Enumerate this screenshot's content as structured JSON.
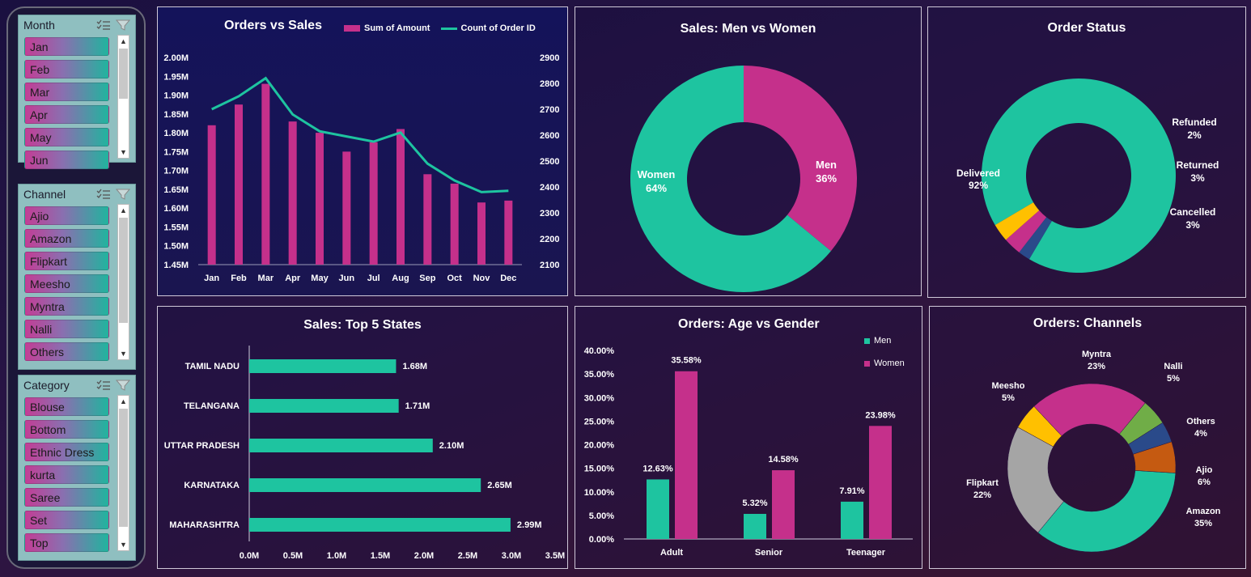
{
  "colors": {
    "teal": "#1ec4a0",
    "magenta": "#c5308b",
    "yellow": "#ffc000",
    "navy": "#2a4a8a",
    "orange": "#c55a11",
    "green": "#70ad47",
    "gray": "#a5a5a5"
  },
  "slicers": {
    "month": {
      "title": "Month",
      "items": [
        "Jan",
        "Feb",
        "Mar",
        "Apr",
        "May",
        "Jun"
      ]
    },
    "channel": {
      "title": "Channel",
      "items": [
        "Ajio",
        "Amazon",
        "Flipkart",
        "Meesho",
        "Myntra",
        "Nalli",
        "Others"
      ]
    },
    "category": {
      "title": "Category",
      "items": [
        "Blouse",
        "Bottom",
        "Ethnic Dress",
        "kurta",
        "Saree",
        "Set",
        "Top"
      ]
    }
  },
  "orders_vs_sales": {
    "title": "Orders vs Sales",
    "legend": {
      "amount": "Sum of Amount",
      "count": "Count of Order ID"
    }
  },
  "men_women": {
    "title": "Sales: Men vs Women",
    "men_label": "Men",
    "men_pct": "36%",
    "women_label": "Women",
    "women_pct": "64%"
  },
  "order_status": {
    "title": "Order Status",
    "delivered_label": "Delivered",
    "delivered_pct": "92%",
    "refunded_label": "Refunded",
    "refunded_pct": "2%",
    "returned_label": "Returned",
    "returned_pct": "3%",
    "cancelled_label": "Cancelled",
    "cancelled_pct": "3%"
  },
  "top_states": {
    "title": "Sales: Top 5 States"
  },
  "age_gender": {
    "title": "Orders: Age vs Gender",
    "legend_men": "Men",
    "legend_women": "Women"
  },
  "channels": {
    "title": "Orders: Channels",
    "labels": {
      "myntra": [
        "Myntra",
        "23%"
      ],
      "nalli": [
        "Nalli",
        "5%"
      ],
      "others": [
        "Others",
        "4%"
      ],
      "ajio": [
        "Ajio",
        "6%"
      ],
      "amazon": [
        "Amazon",
        "35%"
      ],
      "flipkart": [
        "Flipkart",
        "22%"
      ],
      "meesho": [
        "Meesho",
        "5%"
      ]
    }
  },
  "chart_data": [
    {
      "type": "bar+line",
      "title": "Orders vs Sales",
      "categories": [
        "Jan",
        "Feb",
        "Mar",
        "Apr",
        "May",
        "Jun",
        "Jul",
        "Aug",
        "Sep",
        "Oct",
        "Nov",
        "Dec"
      ],
      "series": [
        {
          "name": "Sum of Amount",
          "type": "bar",
          "axis": "left",
          "values": [
            1.82,
            1.875,
            1.93,
            1.83,
            1.8,
            1.75,
            1.775,
            1.81,
            1.69,
            1.665,
            1.615,
            1.62
          ]
        },
        {
          "name": "Count of Order ID",
          "type": "line",
          "axis": "right",
          "values": [
            2700,
            2750,
            2820,
            2680,
            2615,
            2595,
            2575,
            2610,
            2490,
            2425,
            2380,
            2385
          ]
        }
      ],
      "ylim_left": [
        1.45,
        2.0
      ],
      "ylim_right": [
        2100,
        2900
      ],
      "yticks_left": [
        "1.45M",
        "1.50M",
        "1.55M",
        "1.60M",
        "1.65M",
        "1.70M",
        "1.75M",
        "1.80M",
        "1.85M",
        "1.90M",
        "1.95M",
        "2.00M"
      ],
      "yticks_right": [
        "2100",
        "2200",
        "2300",
        "2400",
        "2500",
        "2600",
        "2700",
        "2800",
        "2900"
      ]
    },
    {
      "type": "pie",
      "title": "Sales: Men vs Women",
      "labels": [
        "Men",
        "Women"
      ],
      "values": [
        36,
        64
      ]
    },
    {
      "type": "pie",
      "title": "Order Status",
      "labels": [
        "Delivered",
        "Refunded",
        "Returned",
        "Cancelled"
      ],
      "values": [
        92,
        2,
        3,
        3
      ]
    },
    {
      "type": "bar",
      "orientation": "horizontal",
      "title": "Sales: Top 5 States",
      "categories": [
        "TAMIL NADU",
        "TELANGANA",
        "UTTAR PRADESH",
        "KARNATAKA",
        "MAHARASHTRA"
      ],
      "values": [
        1.68,
        1.71,
        2.1,
        2.65,
        2.99
      ],
      "data_labels": [
        "1.68M",
        "1.71M",
        "2.10M",
        "2.65M",
        "2.99M"
      ],
      "xlim": [
        0,
        3.5
      ],
      "xticks": [
        "0.0M",
        "0.5M",
        "1.0M",
        "1.5M",
        "2.0M",
        "2.5M",
        "3.0M",
        "3.5M"
      ]
    },
    {
      "type": "bar",
      "title": "Orders: Age vs Gender",
      "categories": [
        "Adult",
        "Senior",
        "Teenager"
      ],
      "series": [
        {
          "name": "Men",
          "values": [
            12.63,
            5.32,
            7.91
          ],
          "data_labels": [
            "12.63%",
            "5.32%",
            "7.91%"
          ]
        },
        {
          "name": "Women",
          "values": [
            35.58,
            14.58,
            23.98
          ],
          "data_labels": [
            "35.58%",
            "14.58%",
            "23.98%"
          ]
        }
      ],
      "ylim": [
        0,
        40
      ],
      "yticks": [
        "0.00%",
        "5.00%",
        "10.00%",
        "15.00%",
        "20.00%",
        "25.00%",
        "30.00%",
        "35.00%",
        "40.00%"
      ]
    },
    {
      "type": "pie",
      "title": "Orders: Channels",
      "labels": [
        "Amazon",
        "Flipkart",
        "Meesho",
        "Myntra",
        "Nalli",
        "Others",
        "Ajio"
      ],
      "values": [
        35,
        22,
        5,
        23,
        5,
        4,
        6
      ]
    }
  ]
}
